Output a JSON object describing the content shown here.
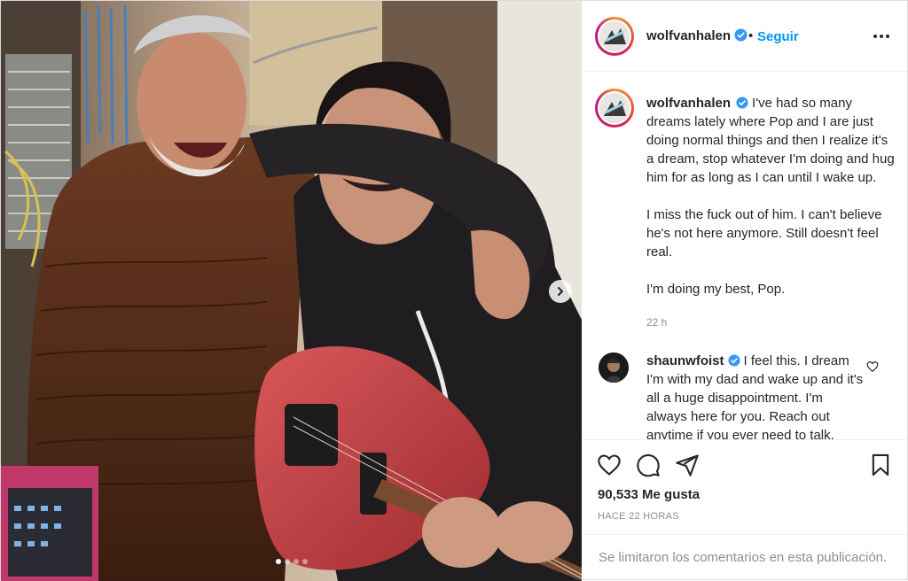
{
  "post": {
    "media": {
      "alt": "",
      "carousel_count": 4,
      "carousel_active": 1
    },
    "author": {
      "username": "wolfvanhalen",
      "verified": true,
      "follow_label": "Seguir",
      "bullet": "•"
    },
    "caption": {
      "username": "wolfvanhalen",
      "paragraphs": [
        "I've had so many dreams lately where Pop and I are just doing normal things and then I realize it's a dream, stop whatever I'm doing and hug him for as long as I can until I wake up.",
        "I miss the fuck out of him. I can't believe he's not here anymore. Still doesn't feel real.",
        "I'm doing my best, Pop."
      ],
      "time": "22 h"
    },
    "comment": {
      "username": "shaunwfoist",
      "verified": true,
      "text": "I feel this. I dream I'm with my dad and wake up and it's all a huge disappointment. I'm always here for you. Reach out anytime if you ever need to talk."
    },
    "likes": "90,533 Me gusta",
    "ago": "HACE 22 HORAS",
    "comments_limited": "Se limitaron los comentarios en esta publicación.",
    "icons": {
      "like": "heart-icon",
      "comment": "comment-icon",
      "share": "share-icon",
      "save": "bookmark-icon",
      "more": "more-icon",
      "next": "chevron-right-icon",
      "verified": "verified-badge-icon"
    },
    "colors": {
      "link": "#0095f6",
      "verified": "#3897f0",
      "muted": "#8e8e8e",
      "text": "#262626"
    }
  }
}
